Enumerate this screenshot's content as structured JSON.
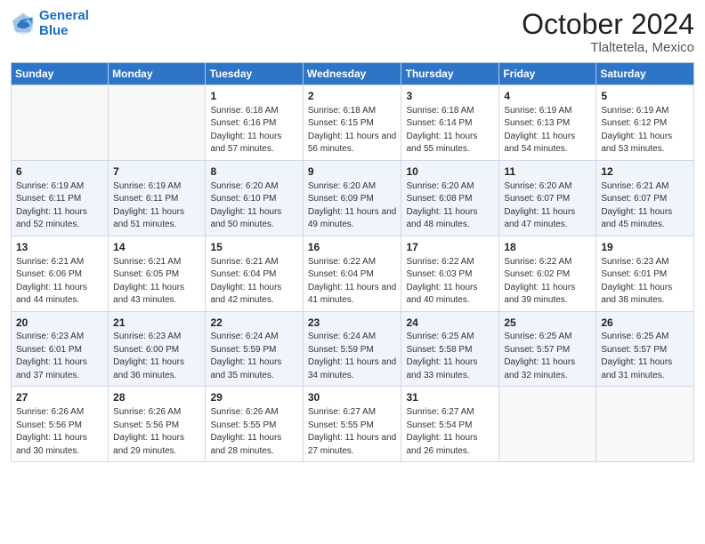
{
  "header": {
    "logo_line1": "General",
    "logo_line2": "Blue",
    "title": "October 2024",
    "subtitle": "Tlaltetela, Mexico"
  },
  "days_of_week": [
    "Sunday",
    "Monday",
    "Tuesday",
    "Wednesday",
    "Thursday",
    "Friday",
    "Saturday"
  ],
  "weeks": [
    [
      {
        "day": "",
        "info": ""
      },
      {
        "day": "",
        "info": ""
      },
      {
        "day": "1",
        "info": "Sunrise: 6:18 AM\nSunset: 6:16 PM\nDaylight: 11 hours and 57 minutes."
      },
      {
        "day": "2",
        "info": "Sunrise: 6:18 AM\nSunset: 6:15 PM\nDaylight: 11 hours and 56 minutes."
      },
      {
        "day": "3",
        "info": "Sunrise: 6:18 AM\nSunset: 6:14 PM\nDaylight: 11 hours and 55 minutes."
      },
      {
        "day": "4",
        "info": "Sunrise: 6:19 AM\nSunset: 6:13 PM\nDaylight: 11 hours and 54 minutes."
      },
      {
        "day": "5",
        "info": "Sunrise: 6:19 AM\nSunset: 6:12 PM\nDaylight: 11 hours and 53 minutes."
      }
    ],
    [
      {
        "day": "6",
        "info": "Sunrise: 6:19 AM\nSunset: 6:11 PM\nDaylight: 11 hours and 52 minutes."
      },
      {
        "day": "7",
        "info": "Sunrise: 6:19 AM\nSunset: 6:11 PM\nDaylight: 11 hours and 51 minutes."
      },
      {
        "day": "8",
        "info": "Sunrise: 6:20 AM\nSunset: 6:10 PM\nDaylight: 11 hours and 50 minutes."
      },
      {
        "day": "9",
        "info": "Sunrise: 6:20 AM\nSunset: 6:09 PM\nDaylight: 11 hours and 49 minutes."
      },
      {
        "day": "10",
        "info": "Sunrise: 6:20 AM\nSunset: 6:08 PM\nDaylight: 11 hours and 48 minutes."
      },
      {
        "day": "11",
        "info": "Sunrise: 6:20 AM\nSunset: 6:07 PM\nDaylight: 11 hours and 47 minutes."
      },
      {
        "day": "12",
        "info": "Sunrise: 6:21 AM\nSunset: 6:07 PM\nDaylight: 11 hours and 45 minutes."
      }
    ],
    [
      {
        "day": "13",
        "info": "Sunrise: 6:21 AM\nSunset: 6:06 PM\nDaylight: 11 hours and 44 minutes."
      },
      {
        "day": "14",
        "info": "Sunrise: 6:21 AM\nSunset: 6:05 PM\nDaylight: 11 hours and 43 minutes."
      },
      {
        "day": "15",
        "info": "Sunrise: 6:21 AM\nSunset: 6:04 PM\nDaylight: 11 hours and 42 minutes."
      },
      {
        "day": "16",
        "info": "Sunrise: 6:22 AM\nSunset: 6:04 PM\nDaylight: 11 hours and 41 minutes."
      },
      {
        "day": "17",
        "info": "Sunrise: 6:22 AM\nSunset: 6:03 PM\nDaylight: 11 hours and 40 minutes."
      },
      {
        "day": "18",
        "info": "Sunrise: 6:22 AM\nSunset: 6:02 PM\nDaylight: 11 hours and 39 minutes."
      },
      {
        "day": "19",
        "info": "Sunrise: 6:23 AM\nSunset: 6:01 PM\nDaylight: 11 hours and 38 minutes."
      }
    ],
    [
      {
        "day": "20",
        "info": "Sunrise: 6:23 AM\nSunset: 6:01 PM\nDaylight: 11 hours and 37 minutes."
      },
      {
        "day": "21",
        "info": "Sunrise: 6:23 AM\nSunset: 6:00 PM\nDaylight: 11 hours and 36 minutes."
      },
      {
        "day": "22",
        "info": "Sunrise: 6:24 AM\nSunset: 5:59 PM\nDaylight: 11 hours and 35 minutes."
      },
      {
        "day": "23",
        "info": "Sunrise: 6:24 AM\nSunset: 5:59 PM\nDaylight: 11 hours and 34 minutes."
      },
      {
        "day": "24",
        "info": "Sunrise: 6:25 AM\nSunset: 5:58 PM\nDaylight: 11 hours and 33 minutes."
      },
      {
        "day": "25",
        "info": "Sunrise: 6:25 AM\nSunset: 5:57 PM\nDaylight: 11 hours and 32 minutes."
      },
      {
        "day": "26",
        "info": "Sunrise: 6:25 AM\nSunset: 5:57 PM\nDaylight: 11 hours and 31 minutes."
      }
    ],
    [
      {
        "day": "27",
        "info": "Sunrise: 6:26 AM\nSunset: 5:56 PM\nDaylight: 11 hours and 30 minutes."
      },
      {
        "day": "28",
        "info": "Sunrise: 6:26 AM\nSunset: 5:56 PM\nDaylight: 11 hours and 29 minutes."
      },
      {
        "day": "29",
        "info": "Sunrise: 6:26 AM\nSunset: 5:55 PM\nDaylight: 11 hours and 28 minutes."
      },
      {
        "day": "30",
        "info": "Sunrise: 6:27 AM\nSunset: 5:55 PM\nDaylight: 11 hours and 27 minutes."
      },
      {
        "day": "31",
        "info": "Sunrise: 6:27 AM\nSunset: 5:54 PM\nDaylight: 11 hours and 26 minutes."
      },
      {
        "day": "",
        "info": ""
      },
      {
        "day": "",
        "info": ""
      }
    ]
  ]
}
